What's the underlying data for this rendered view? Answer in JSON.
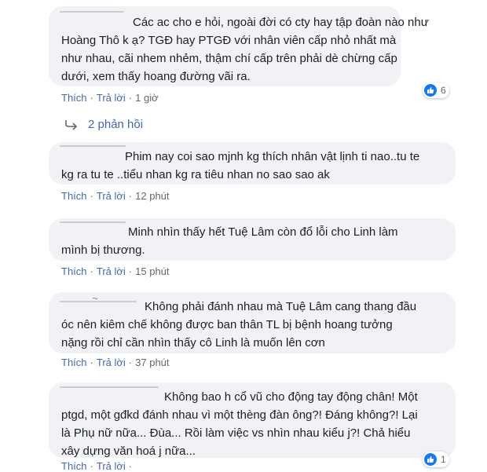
{
  "comments": [
    {
      "lines": [
        "Các ac cho e hỏi, ngoài đời có cty hay tập đoàn nào như",
        "Hoàng Thô k ạ? TGĐ hay PTGĐ với nhân viên cấp nhỏ nhất mà",
        "như nhau, cãi nhem nhẻm, thậm chí cấp trên phải dè chừng cấp",
        "dưới, xem thấy hoang đường vãi ra."
      ],
      "like": "Thích",
      "reply": "Trả lời",
      "time": "1 giờ",
      "reactions": "6"
    },
    {
      "lines": [
        "Phim nay coi sao mjnh kg thích nhân vật lịnh ti nao..tu te",
        "kg ra tu te ..tiểu nhan kg ra tiêu nhan no sao sao ak"
      ],
      "like": "Thích",
      "reply": "Trả lời",
      "time": "12 phút"
    },
    {
      "lines": [
        "Minh nhìn thấy hết Tuệ Lâm còn đổ lỗi cho Linh làm",
        "mình bị thương."
      ],
      "like": "Thích",
      "reply": "Trả lời",
      "time": "15 phút"
    },
    {
      "lines": [
        "Không phải đánh nhau mà Tuệ Lâm cang thang đầu",
        "óc nên kiêm chế không được ban thân TL bị bệnh hoang tưởng",
        "nặng rồi chỉ cần nhìn thấy cô Linh là muốn lên cơn"
      ],
      "like": "Thích",
      "reply": "Trả lời",
      "time": "37 phút"
    },
    {
      "lines": [
        "Không bao h cổ vũ cho động tay động chân! Một",
        "ptgd, một gđkd đánh nhau vì một thèng đàn ông?! Đáng không?! Lại",
        "là Phụ nữ nữa... Đùa... Rồi làm việc vs nhìn nhau kiểu j?! Chả hiểu",
        "xây dựng văn hoá j nữa..."
      ],
      "like": "Thích",
      "reply": "Trả lời",
      "time": "",
      "reactions": "1"
    }
  ],
  "replies_link": "2 phản hồi",
  "redaction_mark": "~",
  "colors": {
    "link": "#4267b2",
    "bubble": "#f0f2f5",
    "like_blue": "#1877f2",
    "meta": "#65676b"
  },
  "icons": [
    "thumbs-up-icon",
    "reply-arrow-icon"
  ]
}
